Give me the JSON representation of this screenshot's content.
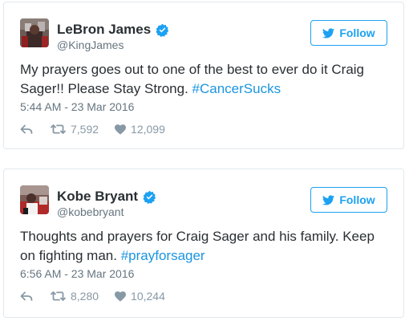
{
  "colors": {
    "accent": "#1da1f2",
    "hashtag": "#1b95e0",
    "muted": "#66757f",
    "border": "#e1e8ed"
  },
  "tweets": [
    {
      "name": "LeBron James",
      "handle": "@KingJames",
      "verified": true,
      "follow_label": "Follow",
      "text_before": "My prayers goes out to one of the best to ever do it Craig Sager!! Please Stay Strong. ",
      "hashtag": "#CancerSucks",
      "timestamp": "5:44 AM - 23 Mar 2016",
      "retweets": "7,592",
      "likes": "12,099",
      "icons": [
        "avatar",
        "verified-badge-icon",
        "twitter-bird-icon",
        "reply-icon",
        "retweet-icon",
        "heart-icon"
      ]
    },
    {
      "name": "Kobe Bryant",
      "handle": "@kobebryant",
      "verified": true,
      "follow_label": "Follow",
      "text_before": "Thoughts and prayers for Craig Sager and his family. Keep on fighting man. ",
      "hashtag": "#prayforsager",
      "timestamp": "6:56 AM - 23 Mar 2016",
      "retweets": "8,280",
      "likes": "10,244",
      "icons": [
        "avatar",
        "verified-badge-icon",
        "twitter-bird-icon",
        "reply-icon",
        "retweet-icon",
        "heart-icon"
      ]
    }
  ]
}
